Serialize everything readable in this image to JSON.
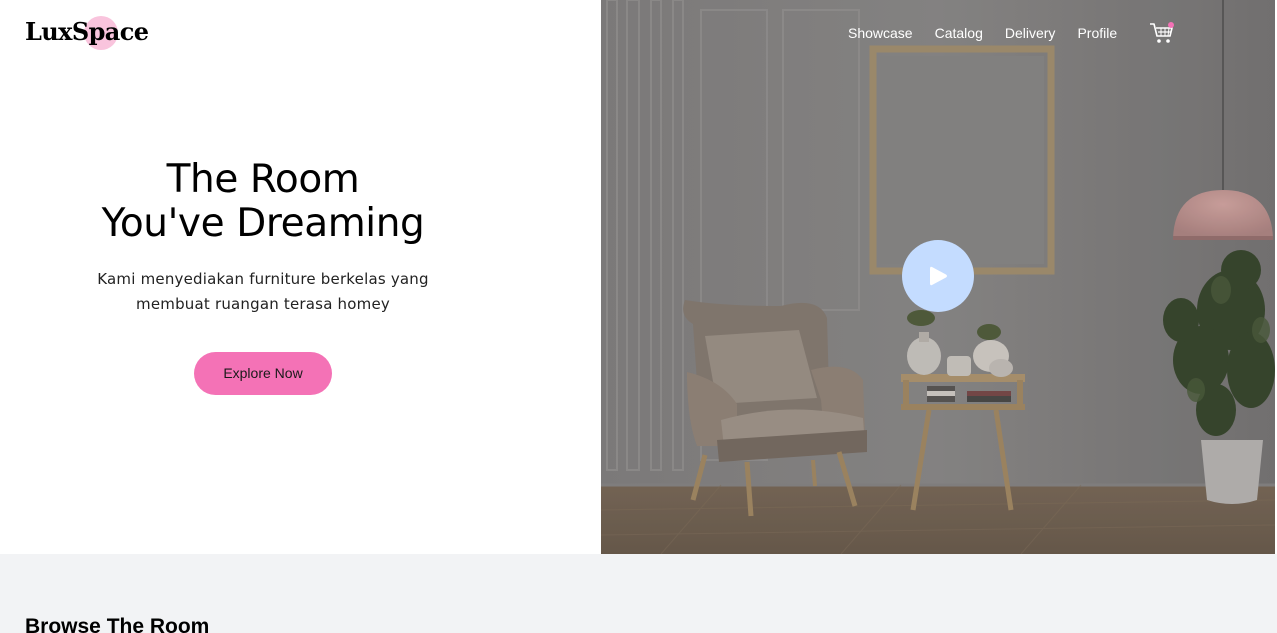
{
  "brand": {
    "name": "LuxSpace",
    "accent_dot_color": "#f9c4dd"
  },
  "nav": {
    "items": [
      {
        "label": "Showcase"
      },
      {
        "label": "Catalog"
      },
      {
        "label": "Delivery"
      },
      {
        "label": "Profile"
      }
    ],
    "cart_icon": "shopping-cart-icon",
    "cart_badge_color": "#f472b6"
  },
  "hero": {
    "title_line1": "The Room",
    "title_line2": "You've Dreaming",
    "subtitle_line1": "Kami menyediakan furniture berkelas yang",
    "subtitle_line2": "membuat ruangan terasa homey",
    "cta_label": "Explore Now",
    "cta_color": "#f472b6",
    "play_icon": "play-icon",
    "play_button_color": "#c4dcff"
  },
  "browse": {
    "title": "Browse The Room"
  },
  "colors": {
    "page_bg": "#ffffff",
    "section_bg": "#f2f3f5"
  }
}
